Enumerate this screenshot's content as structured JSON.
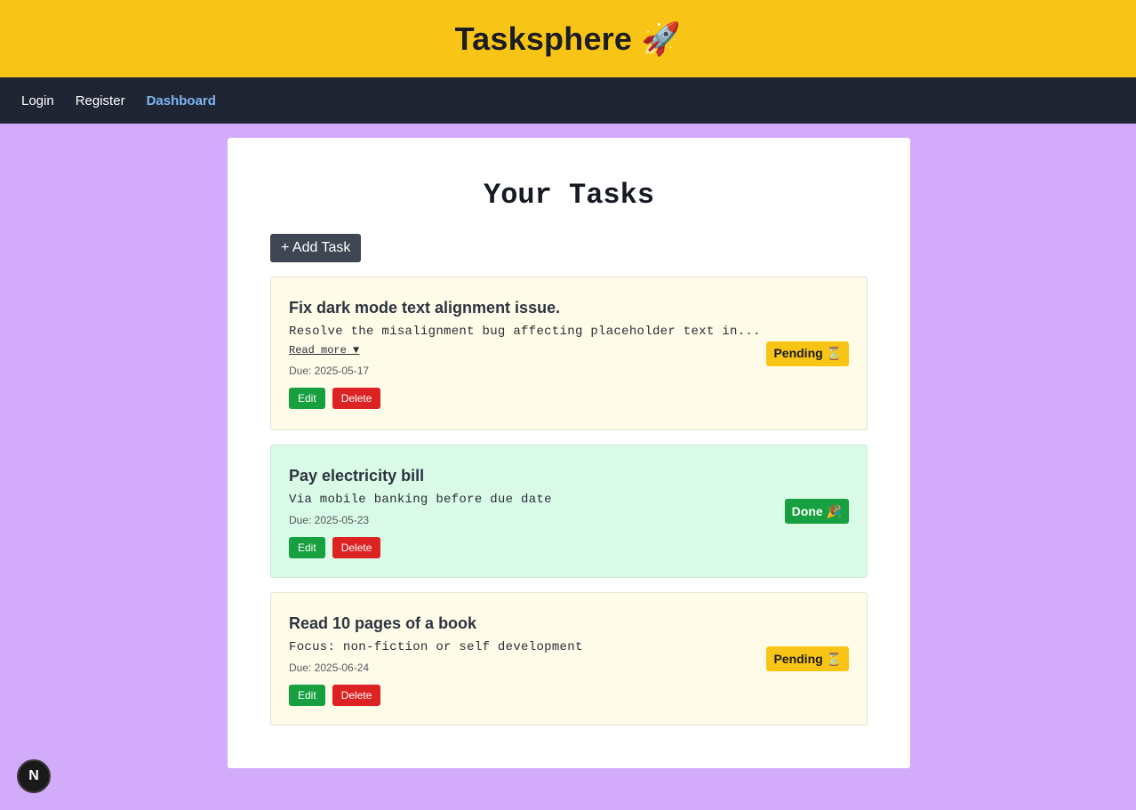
{
  "app": {
    "title": "Tasksphere 🚀"
  },
  "nav": {
    "items": [
      {
        "label": "Login"
      },
      {
        "label": "Register"
      },
      {
        "label": "Dashboard"
      }
    ]
  },
  "main": {
    "title": "Your Tasks",
    "add_task_label": "+ Add Task",
    "tasks": [
      {
        "title": "Fix dark mode text alignment issue.",
        "description": "Resolve the misalignment bug affecting placeholder text in...",
        "read_more": "Read more ▼",
        "due": "Due: 2025-05-17",
        "status": "Pending ⏳",
        "edit_label": "Edit",
        "delete_label": "Delete"
      },
      {
        "title": "Pay electricity bill",
        "description": "Via mobile banking before due date",
        "due": "Due: 2025-05-23",
        "status": "Done 🎉",
        "edit_label": "Edit",
        "delete_label": "Delete"
      },
      {
        "title": "Read 10 pages of a book",
        "description": "Focus: non-fiction or self development",
        "due": "Due: 2025-06-24",
        "status": "Pending ⏳",
        "edit_label": "Edit",
        "delete_label": "Delete"
      }
    ]
  },
  "dev_overlay": {
    "label": "N"
  },
  "colors": {
    "header_bg": "#f8c516",
    "nav_bg": "#1f2532",
    "page_bg": "#d2abfb",
    "pending_card_bg": "#fefce8",
    "done_card_bg": "#d8fae6",
    "edit_btn": "#16a03f",
    "delete_btn": "#dc2222",
    "nav_active": "#7fb6f4"
  }
}
